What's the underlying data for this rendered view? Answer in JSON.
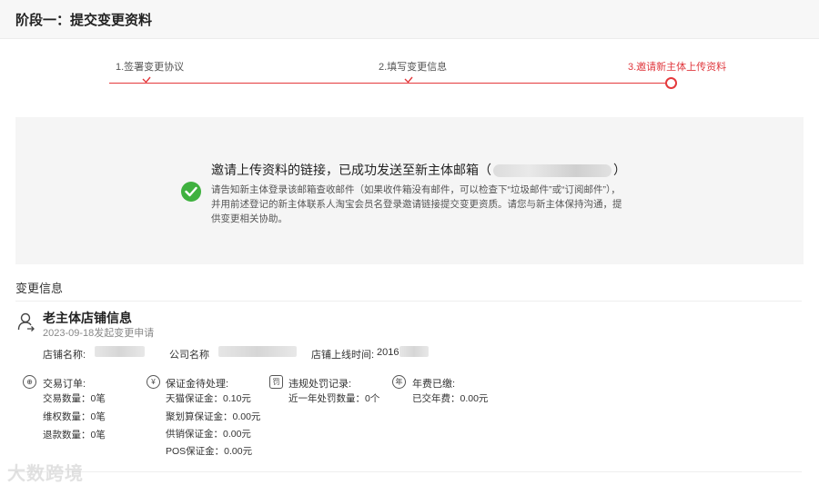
{
  "header": {
    "title": "阶段一：提交变更资料"
  },
  "steps": [
    {
      "label": "1.签署变更协议",
      "state": "done"
    },
    {
      "label": "2.填写变更信息",
      "state": "done"
    },
    {
      "label": "3.邀请新主体上传资料",
      "state": "current"
    }
  ],
  "notice": {
    "main_before": "邀请上传资料的链接，已成功发送至新主体邮箱（",
    "main_after": "）",
    "desc": "请告知新主体登录该邮箱查收邮件（如果收件箱没有邮件，可以检查下“垃圾邮件”或“订阅邮件”），并用前述登记的新主体联系人淘宝会员名登录邀请链接提交变更资质。请您与新主体保持沟通，提供变更相关协助。"
  },
  "section": {
    "title": "变更信息"
  },
  "store": {
    "title": "老主体店铺信息",
    "date": "2023-09-18发起变更申请",
    "name_label": "店铺名称:",
    "company_label": "公司名称",
    "online_label": "店铺上线时间:",
    "online_value": "2016"
  },
  "groups": {
    "orders": {
      "title": "交易订单:",
      "rows": [
        "交易数量：0笔",
        "维权数量：0笔",
        "退款数量：0笔"
      ]
    },
    "deposit": {
      "title": "保证金待处理:",
      "rows": [
        "天猫保证金：0.10元",
        "聚划算保证金：0.00元",
        "供销保证金：0.00元",
        "POS保证金：0.00元"
      ]
    },
    "violation": {
      "title": "违规处罚记录:",
      "rows": [
        "近一年处罚数量：0个"
      ]
    },
    "fee": {
      "title": "年费已缴:",
      "rows": [
        "已交年费：0.00元"
      ]
    }
  },
  "watermark": "大数跨境",
  "colors": {
    "accent": "#e4393c",
    "success": "#3fb13f"
  }
}
